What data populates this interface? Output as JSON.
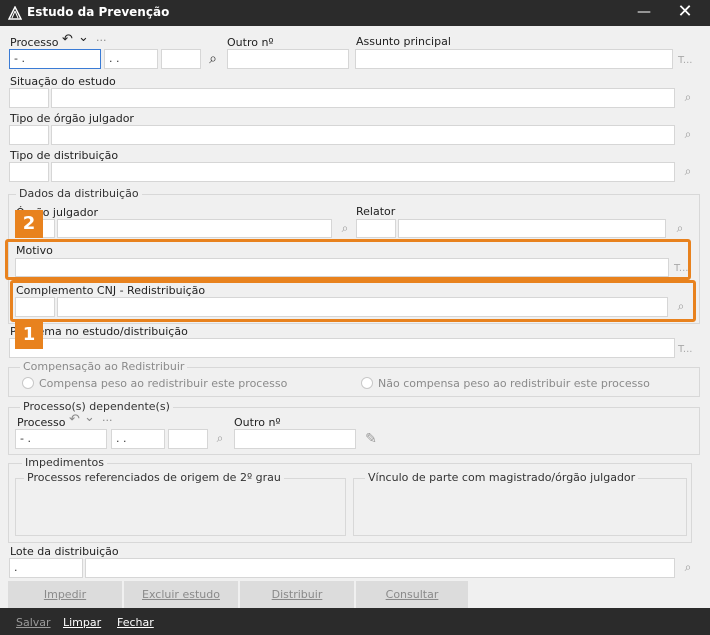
{
  "window": {
    "title": "Estudo da Prevenção",
    "minimize_glyph": "—",
    "close_glyph": "✕"
  },
  "processo": {
    "label": "Processo",
    "undo_glyph": "↶",
    "dropdown_glyph": "⌄",
    "more_glyph": "···",
    "field1": "   -  .",
    "field2": " . .",
    "outro_label": "Outro nº",
    "assunto_label": "Assunto principal",
    "tdots": "T..."
  },
  "situacao": {
    "label": "Situação do estudo"
  },
  "tipo_orgao": {
    "label": "Tipo de órgão julgador"
  },
  "tipo_distribuicao": {
    "label": "Tipo de distribuição"
  },
  "dados_distribuicao": {
    "title": "Dados da distribuição",
    "orgao_label": "Órgão julgador",
    "relator_label": "Relator"
  },
  "motivo": {
    "label": "Motivo",
    "tdots": "T..."
  },
  "complemento": {
    "label": "Complemento CNJ - Redistribuição"
  },
  "problema": {
    "label": "Problema no estudo/distribuição",
    "tdots": "T..."
  },
  "compensacao": {
    "title": "Compensação ao Redistribuir",
    "opt1": "Compensa peso ao redistribuir este processo",
    "opt2": "Não compensa peso ao redistribuir este processo"
  },
  "dependentes": {
    "title": "Processo(s) dependente(s)",
    "processo_label": "Processo",
    "undo_glyph": "↶",
    "dropdown_glyph": "⌄",
    "more_glyph": "···",
    "field1": "   -  .",
    "field2": " . .",
    "outro_label": "Outro nº"
  },
  "impedimentos": {
    "title": "Impedimentos",
    "left_title": "Processos referenciados de origem de 2º grau",
    "right_title": "Vínculo de parte com magistrado/órgão julgador"
  },
  "lote": {
    "label": "Lote da distribuição",
    "value": "    ."
  },
  "actions": {
    "impedir": "Impedir",
    "excluir": "Excluir estudo",
    "distribuir": "Distribuir",
    "consultar": "Consultar"
  },
  "footer": {
    "salvar": "Salvar",
    "limpar": "Limpar",
    "fechar": "Fechar"
  },
  "badges": {
    "one": "1",
    "two": "2"
  },
  "icons": {
    "search": "⌕",
    "pencil": "✎"
  },
  "colors": {
    "highlight": "#e8821e",
    "titlebar": "#2b2b2b",
    "focus": "#3a7bd5"
  }
}
